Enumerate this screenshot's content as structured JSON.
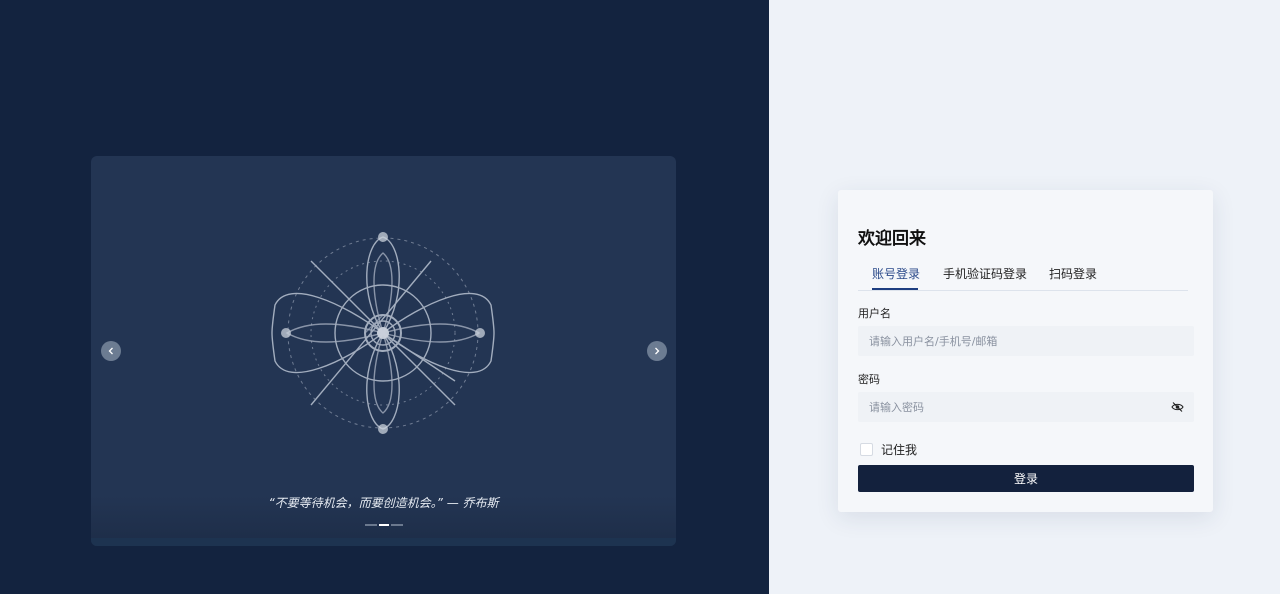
{
  "carousel": {
    "quote": "“不要等待机会，而要创造机会。” — 乔布斯",
    "prev_icon": "chevron-left-icon",
    "next_icon": "chevron-right-icon",
    "slide_count": 3,
    "active_slide": 2
  },
  "login": {
    "title": "欢迎回来",
    "tabs": [
      {
        "label": "账号登录",
        "active": true
      },
      {
        "label": "手机验证码登录",
        "active": false
      },
      {
        "label": "扫码登录",
        "active": false
      }
    ],
    "username": {
      "label": "用户名",
      "placeholder": "请输入用户名/手机号/邮箱",
      "value": ""
    },
    "password": {
      "label": "密码",
      "placeholder": "请输入密码",
      "value": "",
      "toggle_icon": "eye-off-icon"
    },
    "remember": {
      "label": "记住我",
      "checked": false
    },
    "submit_label": "登录"
  },
  "colors": {
    "left_background": "#13233f",
    "right_background": "#eef2f8",
    "button": "#13213d",
    "active_tab": "#2b4a8a"
  }
}
